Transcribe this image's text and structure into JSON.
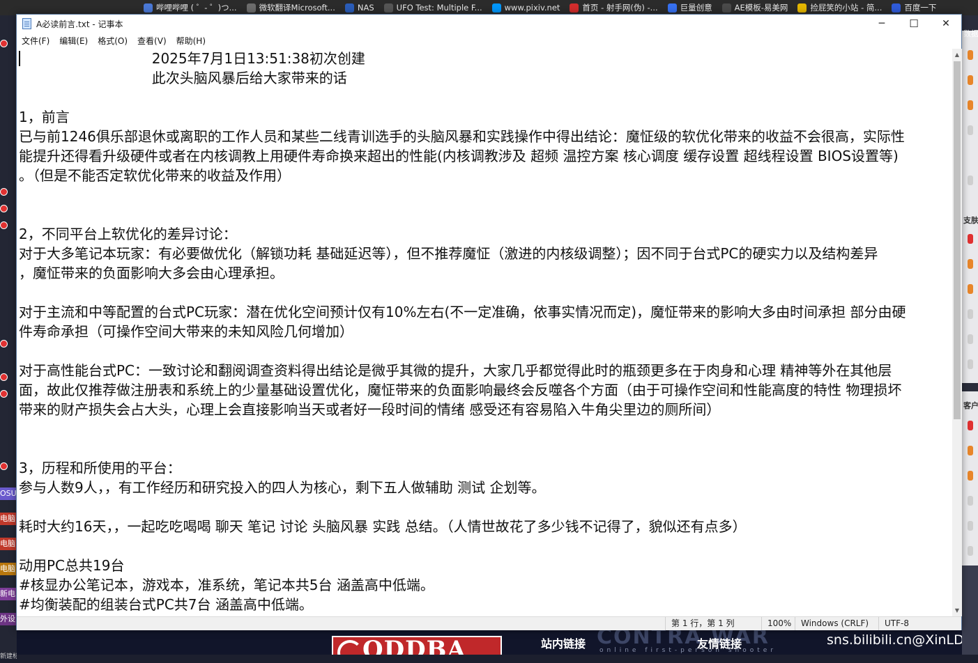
{
  "bookmarks": [
    {
      "label": "哔哩哔哩 ( ゜- ゜)つ...",
      "icon": "bilibili-icon",
      "color": "#4a78d6"
    },
    {
      "label": "微软翻译Microsoft...",
      "icon": "translate-icon",
      "color": "#6c6c6c"
    },
    {
      "label": "NAS",
      "icon": "dsm-icon",
      "color": "#2a5cb8"
    },
    {
      "label": "UFO Test: Multiple F...",
      "icon": "ufo-icon",
      "color": "#555555"
    },
    {
      "label": "www.pixiv.net",
      "icon": "pixiv-icon",
      "color": "#0096fa"
    },
    {
      "label": "首页 - 射手网(伪) -...",
      "icon": "shooter-icon",
      "color": "#d12c2c"
    },
    {
      "label": "巨量创意",
      "icon": "ocean-icon",
      "color": "#3670f0"
    },
    {
      "label": "AE模板-易美网",
      "icon": "ae-icon",
      "color": "#4a4a4a"
    },
    {
      "label": "捡屁笑的小站 - 简...",
      "icon": "smile-icon",
      "color": "#e4b600"
    },
    {
      "label": "百度一下",
      "icon": "baidu-icon",
      "color": "#2f5bd9"
    }
  ],
  "left_tags": [
    "OSU",
    "电脑",
    "电脑",
    "电脑",
    "新电",
    "外设",
    "新建标签页"
  ],
  "right_labels": [
    "数据",
    "支肤",
    "客户"
  ],
  "notepad": {
    "title": "A必读前言.txt - 记事本",
    "minimize": "─",
    "maximize": "☐",
    "close": "✕",
    "menu": [
      "文件(F)",
      "编辑(E)",
      "格式(O)",
      "查看(V)",
      "帮助(H)"
    ],
    "lines": [
      "                              2025年7月1日13:51:38初次创建",
      "                              此次头脑风暴后给大家带来的话",
      "",
      "1，前言",
      "已与前1246俱乐部退休或离职的工作人员和某些二线青训选手的头脑风暴和实践操作中得出结论：魔怔级的软优化带来的收益不会很高，实际性",
      "能提升还得看升级硬件或者在内核调教上用硬件寿命换来超出的性能(内核调教涉及 超频 温控方案 核心调度 缓存设置 超线程设置 BIOS设置等)",
      "。（但是不能否定软优化带来的收益及作用）",
      "",
      "",
      "2，不同平台上软优化的差异讨论：",
      "对于大多笔记本玩家：有必要做优化（解锁功耗 基础延迟等），但不推荐魔怔（激进的内核级调整）；因不同于台式PC的硬实力以及结构差异",
      "，魔怔带来的负面影响大多会由心理承担。",
      "",
      "对于主流和中等配置的台式PC玩家：潜在优化空间预计仅有10%左右(不一定准确，依事实情况而定)，魔怔带来的影响大多由时间承担 部分由硬",
      "件寿命承担（可操作空间大带来的未知风险几何增加）",
      "",
      "对于高性能台式PC：一致讨论和翻阅调查资料得出结论是微乎其微的提升，大家几乎都觉得此时的瓶颈更多在于肉身和心理 精神等外在其他层",
      "面，故此仅推荐做注册表和系统上的少量基础设置优化，魔怔带来的负面影响最终会反噬各个方面（由于可操作空间和性能高度的特性 物理损坏",
      "带来的财产损失会占大头，心理上会直接影响当天或者好一段时间的情绪 感受还有容易陷入牛角尖里边的厕所间）",
      "",
      "",
      "3，历程和所使用的平台：",
      "参与人数9人，，有工作经历和研究投入的四人为核心，剩下五人做辅助 测试 企划等。",
      "",
      "耗时大约16天，，一起吃吃喝喝 聊天 笔记 讨论 头脑风暴 实践 总结。（人情世故花了多少钱不记得了，貌似还有点多）",
      "",
      "动用PC总共19台",
      "#核显办公笔记本，游戏本，准系统，笔记本共5台 涵盖高中低端。",
      "#均衡装配的组装台式PC共7台 涵盖高中低端。"
    ],
    "status": {
      "position": "第 1 行，第 1 列",
      "zoom": "100%",
      "line_ending": "Windows (CRLF)",
      "encoding": "UTF-8"
    }
  },
  "bottom": {
    "logo_text": "ODDBA",
    "bg_text": "CONTRA WAR",
    "bg_subtext": "online first-person shooter",
    "link1": "站内链接",
    "link2": "友情链接",
    "credit": "sns.bilibili.cn@XinLD"
  },
  "colors": {
    "accent_red": "#e03131",
    "window_border": "#5d7ba1"
  }
}
